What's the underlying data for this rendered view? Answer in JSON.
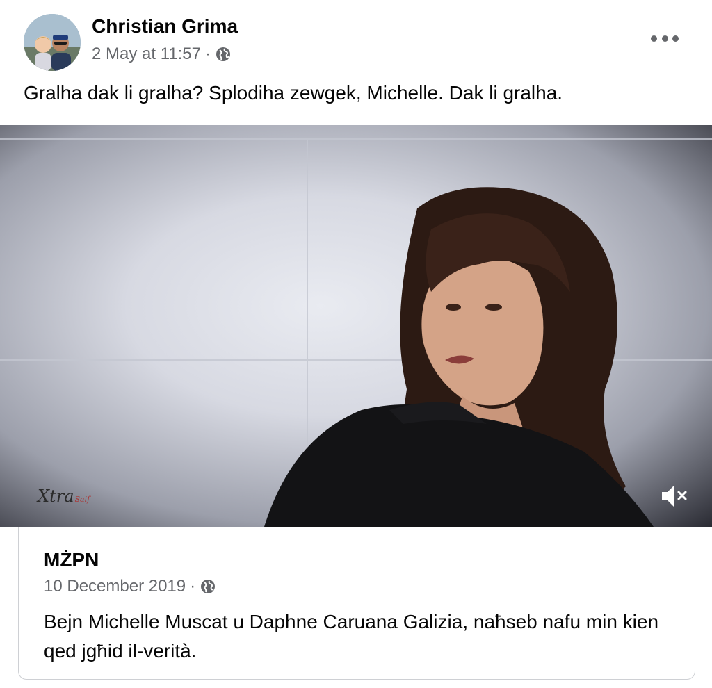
{
  "post": {
    "author": "Christian Grima",
    "date": "2 May at 11:57",
    "separator": "·",
    "audience_icon": "globe-icon",
    "more_icon": "more-options-icon",
    "text": "Gralha dak li gralha? Splodiha zewgek, Michelle. Dak li gralha."
  },
  "video": {
    "watermark_main": "Xtra",
    "watermark_sub": "Saif",
    "mute_icon": "speaker-muted-icon"
  },
  "shared": {
    "author": "MŻPN",
    "date": "10 December 2019",
    "separator": "·",
    "audience_icon": "globe-icon",
    "text": "Bejn Michelle Muscat u Daphne Caruana Galizia, naħseb nafu min kien qed jgħid il-verità."
  },
  "colors": {
    "primary_text": "#050505",
    "secondary_text": "#65676b",
    "card_border": "#ced0d4"
  }
}
